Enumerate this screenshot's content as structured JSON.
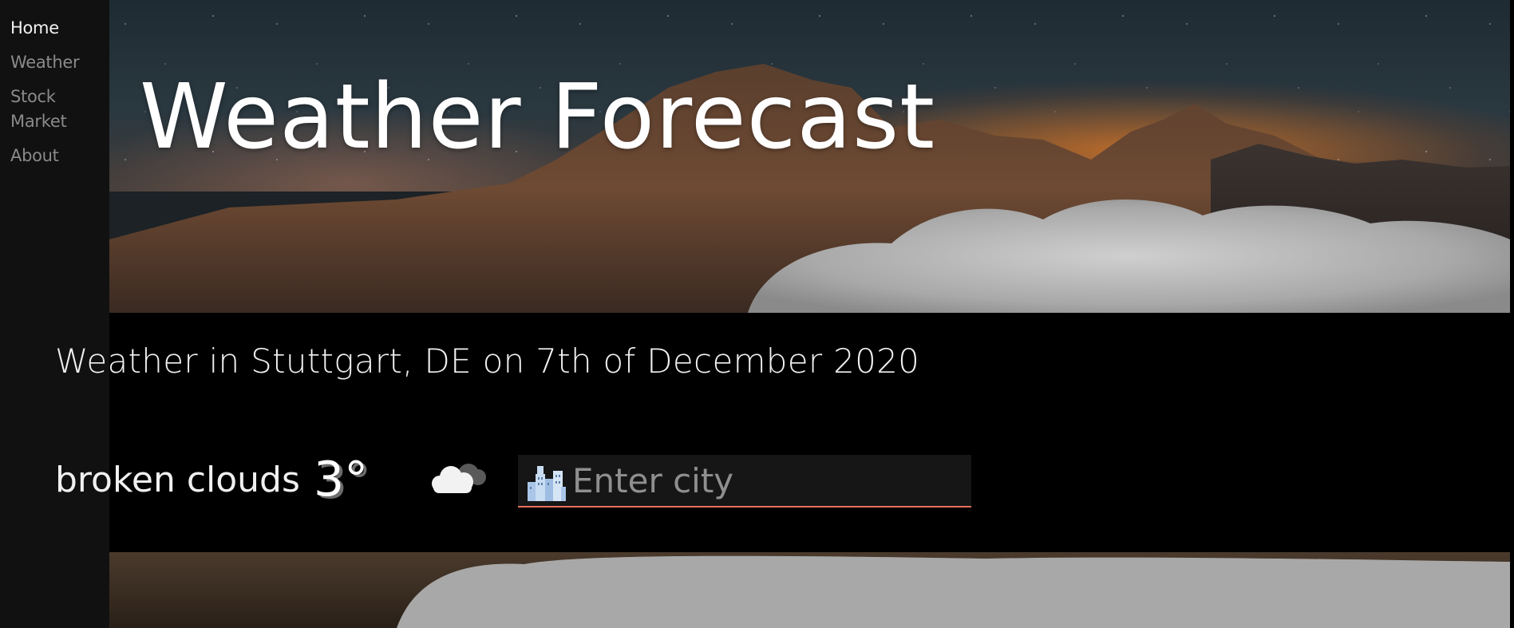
{
  "nav": {
    "items": [
      {
        "label": "Home",
        "active": true
      },
      {
        "label": "Weather",
        "active": false
      },
      {
        "label": "Stock Market",
        "active": false
      },
      {
        "label": "About",
        "active": false
      }
    ]
  },
  "hero": {
    "title": "Weather Forecast"
  },
  "forecast": {
    "headline": "Weather in Stuttgart, DE on 7th of December 2020",
    "condition": "broken clouds",
    "temperature": "3°",
    "weather_icon": "cloud-icon"
  },
  "search": {
    "placeholder": "Enter city",
    "value": "",
    "icon": "city-buildings-icon"
  },
  "colors": {
    "sidebar_bg": "#111111",
    "band_bg": "#000000",
    "input_underline": "#e8705b",
    "nav_active": "#f2f2f2",
    "nav_inactive": "#8a8a8a"
  }
}
